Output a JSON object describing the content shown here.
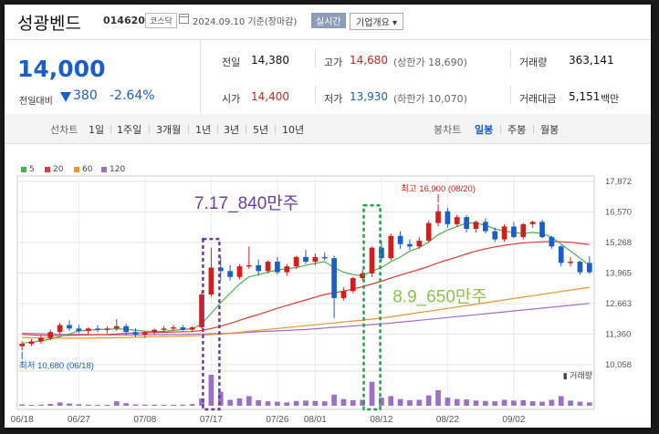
{
  "header": {
    "stock_name": "성광벤드",
    "stock_code": "014620",
    "market": "코스닥",
    "as_of": "2024.09.10  기준(장마감)",
    "realtime_label": "실시간",
    "company_info_label": "기업개요 ▾"
  },
  "quote": {
    "price": "14,000",
    "change_label": "전일대비",
    "change": "380",
    "change_pct": "-2.64%",
    "prev_close_label": "전일",
    "prev_close": "14,380",
    "high_label": "고가",
    "high": "14,680",
    "upper_limit": "(상한가 18,690)",
    "volume_label": "거래량",
    "volume": "363,141",
    "open_label": "시가",
    "open": "14,400",
    "low_label": "저가",
    "low": "13,930",
    "lower_limit": "(하한가 10,070)",
    "amount_label": "거래대금",
    "amount": "5,151",
    "amount_unit": "백만"
  },
  "toolbar": {
    "line_chart_label": "선차트",
    "periods": [
      "1일",
      "1주일",
      "3개월",
      "1년",
      "3년",
      "5년",
      "10년"
    ],
    "candle_label": "봉차트",
    "candle_periods": [
      "일봉",
      "주봉",
      "월봉"
    ]
  },
  "colors": {
    "up": "#d51d1d",
    "down": "#1a5fc9",
    "ma5": "#4caf50",
    "ma20": "#e53935",
    "ma60": "#f0932b",
    "ma120": "#9c6fc9",
    "volume": "#9c6fc9",
    "annot_purple": "#6a3ea1",
    "annot_green": "#8bc34a"
  },
  "chart_data": {
    "type": "candlestick",
    "legend": [
      {
        "name": "5",
        "color": "#4caf50"
      },
      {
        "name": "20",
        "color": "#e53935"
      },
      {
        "name": "60",
        "color": "#f0932b"
      },
      {
        "name": "120",
        "color": "#9c6fc9"
      }
    ],
    "y_ticks": [
      "17,872",
      "16,570",
      "15,268",
      "13,965",
      "12,663",
      "11,360",
      "10,058"
    ],
    "ylim": [
      10058,
      17872
    ],
    "x_ticks": [
      "06/18",
      "06/27",
      "07/08",
      "07/17",
      "07/26",
      "08/01",
      "08/12",
      "08/22",
      "09/02"
    ],
    "x_tick_index": [
      0,
      6,
      13,
      20,
      27,
      31,
      38,
      45,
      52
    ],
    "volume_label": "거래량",
    "max_label": "최고 16,900 (08/20)",
    "min_label": "최저 10,680 (06/18)",
    "annotation_1": "7.17_840만주",
    "annotation_2": "8.9_650만주",
    "candles": [
      {
        "o": 10850,
        "h": 11050,
        "l": 10680,
        "c": 10950
      },
      {
        "o": 10950,
        "h": 11150,
        "l": 10850,
        "c": 11050
      },
      {
        "o": 11050,
        "h": 11300,
        "l": 10950,
        "c": 11200
      },
      {
        "o": 11200,
        "h": 11550,
        "l": 11100,
        "c": 11450
      },
      {
        "o": 11450,
        "h": 11850,
        "l": 11350,
        "c": 11750
      },
      {
        "o": 11750,
        "h": 11950,
        "l": 11500,
        "c": 11600
      },
      {
        "o": 11600,
        "h": 11750,
        "l": 11400,
        "c": 11500
      },
      {
        "o": 11500,
        "h": 11650,
        "l": 11350,
        "c": 11600
      },
      {
        "o": 11600,
        "h": 11750,
        "l": 11450,
        "c": 11550
      },
      {
        "o": 11550,
        "h": 11700,
        "l": 11400,
        "c": 11600
      },
      {
        "o": 11600,
        "h": 12000,
        "l": 11500,
        "c": 11700
      },
      {
        "o": 11700,
        "h": 11800,
        "l": 11300,
        "c": 11450
      },
      {
        "o": 11450,
        "h": 11600,
        "l": 11250,
        "c": 11350
      },
      {
        "o": 11350,
        "h": 11500,
        "l": 11200,
        "c": 11450
      },
      {
        "o": 11450,
        "h": 11600,
        "l": 11350,
        "c": 11550
      },
      {
        "o": 11550,
        "h": 11700,
        "l": 11450,
        "c": 11600
      },
      {
        "o": 11600,
        "h": 11750,
        "l": 11500,
        "c": 11650
      },
      {
        "o": 11650,
        "h": 11750,
        "l": 11500,
        "c": 11550
      },
      {
        "o": 11550,
        "h": 11700,
        "l": 11450,
        "c": 11650
      },
      {
        "o": 11650,
        "h": 13200,
        "l": 11600,
        "c": 13050
      },
      {
        "o": 13050,
        "h": 15050,
        "l": 12950,
        "c": 14200
      },
      {
        "o": 14200,
        "h": 14650,
        "l": 13650,
        "c": 14050
      },
      {
        "o": 14050,
        "h": 14300,
        "l": 13650,
        "c": 13800
      },
      {
        "o": 13800,
        "h": 14350,
        "l": 13700,
        "c": 14250
      },
      {
        "o": 14250,
        "h": 15100,
        "l": 14150,
        "c": 14300
      },
      {
        "o": 14300,
        "h": 14550,
        "l": 13850,
        "c": 14050
      },
      {
        "o": 14050,
        "h": 14500,
        "l": 13950,
        "c": 14450
      },
      {
        "o": 14450,
        "h": 14650,
        "l": 13900,
        "c": 14000
      },
      {
        "o": 14000,
        "h": 14350,
        "l": 13850,
        "c": 14250
      },
      {
        "o": 14250,
        "h": 14700,
        "l": 14150,
        "c": 14650
      },
      {
        "o": 14650,
        "h": 14950,
        "l": 14350,
        "c": 14450
      },
      {
        "o": 14450,
        "h": 14800,
        "l": 14300,
        "c": 14650
      },
      {
        "o": 14650,
        "h": 14850,
        "l": 14500,
        "c": 14600
      },
      {
        "o": 14600,
        "h": 14700,
        "l": 12050,
        "c": 12900
      },
      {
        "o": 12900,
        "h": 13350,
        "l": 12800,
        "c": 13200
      },
      {
        "o": 13200,
        "h": 13800,
        "l": 13100,
        "c": 13750
      },
      {
        "o": 13750,
        "h": 14100,
        "l": 13650,
        "c": 13950
      },
      {
        "o": 13950,
        "h": 15100,
        "l": 13800,
        "c": 15050
      },
      {
        "o": 15050,
        "h": 15350,
        "l": 14450,
        "c": 14600
      },
      {
        "o": 14600,
        "h": 15650,
        "l": 14500,
        "c": 15550
      },
      {
        "o": 15550,
        "h": 15750,
        "l": 15000,
        "c": 15200
      },
      {
        "o": 15200,
        "h": 15400,
        "l": 14950,
        "c": 15100
      },
      {
        "o": 15100,
        "h": 15500,
        "l": 15000,
        "c": 15350
      },
      {
        "o": 15350,
        "h": 16200,
        "l": 15250,
        "c": 16100
      },
      {
        "o": 16100,
        "h": 16900,
        "l": 15950,
        "c": 16600
      },
      {
        "o": 16600,
        "h": 16750,
        "l": 15900,
        "c": 16050
      },
      {
        "o": 16050,
        "h": 16450,
        "l": 15950,
        "c": 16350
      },
      {
        "o": 16350,
        "h": 16450,
        "l": 15700,
        "c": 15850
      },
      {
        "o": 15850,
        "h": 16200,
        "l": 15700,
        "c": 16150
      },
      {
        "o": 16150,
        "h": 16300,
        "l": 15650,
        "c": 15750
      },
      {
        "o": 15750,
        "h": 15900,
        "l": 15300,
        "c": 15400
      },
      {
        "o": 15400,
        "h": 16050,
        "l": 15300,
        "c": 15950
      },
      {
        "o": 15950,
        "h": 16150,
        "l": 15450,
        "c": 15500
      },
      {
        "o": 15500,
        "h": 16100,
        "l": 15400,
        "c": 16050
      },
      {
        "o": 16050,
        "h": 16200,
        "l": 15900,
        "c": 16150
      },
      {
        "o": 16150,
        "h": 16250,
        "l": 15450,
        "c": 15500
      },
      {
        "o": 15500,
        "h": 15550,
        "l": 15000,
        "c": 15100
      },
      {
        "o": 15100,
        "h": 15150,
        "l": 14250,
        "c": 14400
      },
      {
        "o": 14400,
        "h": 14650,
        "l": 14250,
        "c": 14450
      },
      {
        "o": 14450,
        "h": 14500,
        "l": 13900,
        "c": 14000
      },
      {
        "o": 14400,
        "h": 14680,
        "l": 13930,
        "c": 14000
      }
    ],
    "volume": [
      35,
      25,
      30,
      50,
      90,
      60,
      40,
      30,
      25,
      28,
      120,
      70,
      35,
      30,
      30,
      25,
      25,
      30,
      45,
      200,
      840,
      380,
      160,
      200,
      260,
      150,
      120,
      110,
      90,
      130,
      140,
      130,
      120,
      300,
      180,
      150,
      160,
      650,
      220,
      260,
      180,
      150,
      160,
      280,
      420,
      220,
      180,
      170,
      140,
      130,
      120,
      160,
      140,
      150,
      120,
      110,
      160,
      260,
      140,
      110,
      90
    ],
    "ma5": [
      10980,
      11020,
      11070,
      11150,
      11250,
      11370,
      11500,
      11520,
      11560,
      11570,
      11590,
      11570,
      11530,
      11490,
      11470,
      11480,
      11520,
      11560,
      11590,
      11800,
      12250,
      12700,
      13100,
      13500,
      13800,
      13900,
      14000,
      14100,
      14150,
      14200,
      14300,
      14380,
      14450,
      14200,
      14000,
      13900,
      13850,
      14050,
      14200,
      14450,
      14650,
      14900,
      15050,
      15300,
      15600,
      15800,
      15950,
      16100,
      16100,
      16000,
      15850,
      15750,
      15700,
      15650,
      15700,
      15650,
      15500,
      15200,
      14900,
      14600,
      14300
    ],
    "ma20": [
      11350,
      11330,
      11310,
      11300,
      11300,
      11310,
      11320,
      11330,
      11340,
      11350,
      11370,
      11390,
      11410,
      11420,
      11430,
      11440,
      11450,
      11460,
      11470,
      11520,
      11600,
      11700,
      11820,
      11950,
      12080,
      12200,
      12330,
      12460,
      12580,
      12700,
      12820,
      12940,
      13050,
      13120,
      13200,
      13290,
      13380,
      13500,
      13620,
      13750,
      13880,
      14000,
      14120,
      14250,
      14400,
      14530,
      14650,
      14780,
      14900,
      15000,
      15080,
      15150,
      15200,
      15250,
      15280,
      15300,
      15310,
      15300,
      15280,
      15230,
      15180
    ],
    "ma60": [
      11220,
      11210,
      11200,
      11190,
      11190,
      11190,
      11190,
      11190,
      11200,
      11200,
      11210,
      11220,
      11230,
      11240,
      11250,
      11260,
      11270,
      11280,
      11290,
      11310,
      11340,
      11370,
      11400,
      11440,
      11480,
      11520,
      11560,
      11600,
      11640,
      11680,
      11720,
      11760,
      11800,
      11840,
      11880,
      11920,
      11960,
      12000,
      12050,
      12100,
      12160,
      12220,
      12280,
      12340,
      12400,
      12460,
      12520,
      12580,
      12640,
      12700,
      12760,
      12820,
      12880,
      12940,
      13000,
      13060,
      13120,
      13180,
      13240,
      13300,
      13360
    ],
    "ma120": [
      11400,
      11390,
      11380,
      11370,
      11360,
      11350,
      11350,
      11340,
      11340,
      11330,
      11330,
      11330,
      11330,
      11330,
      11340,
      11340,
      11350,
      11350,
      11360,
      11370,
      11380,
      11390,
      11400,
      11420,
      11440,
      11460,
      11480,
      11500,
      11520,
      11540,
      11560,
      11590,
      11620,
      11650,
      11680,
      11710,
      11740,
      11770,
      11800,
      11830,
      11870,
      11910,
      11950,
      11990,
      12030,
      12070,
      12110,
      12150,
      12190,
      12230,
      12270,
      12310,
      12350,
      12390,
      12430,
      12470,
      12510,
      12550,
      12590,
      12630,
      12670
    ]
  }
}
